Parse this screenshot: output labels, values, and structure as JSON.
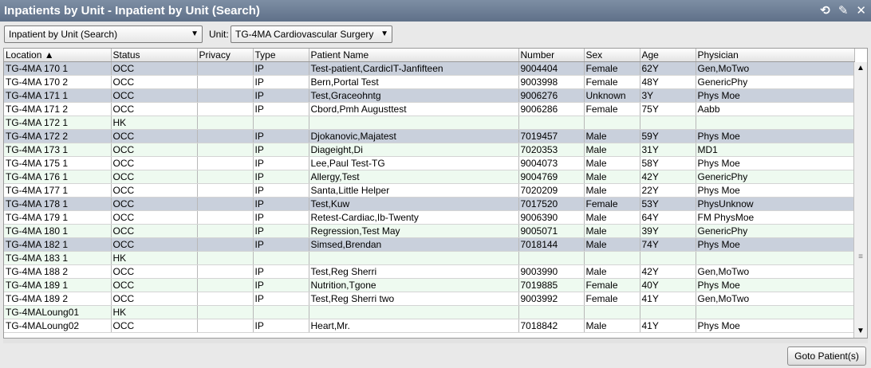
{
  "window": {
    "title": "Inpatients by Unit - Inpatient by Unit (Search)"
  },
  "toolbar": {
    "view_select": "Inpatient by Unit (Search)",
    "unit_label": "Unit:",
    "unit_select": "TG-4MA Cardiovascular Surgery"
  },
  "columns": [
    "Location",
    "Status",
    "Privacy",
    "Type",
    "Patient Name",
    "Number",
    "Sex",
    "Age",
    "Physician"
  ],
  "rows": [
    {
      "location": "TG-4MA 170 1",
      "status": "OCC",
      "privacy": "",
      "type": "IP",
      "name": "Test-patient,CardicIT-Janfifteen",
      "number": "9004404",
      "sex": "Female",
      "age": "62Y",
      "physician": "Gen,MoTwo",
      "style": "sel"
    },
    {
      "location": "TG-4MA 170 2",
      "status": "OCC",
      "privacy": "",
      "type": "IP",
      "name": "Bern,Portal Test",
      "number": "9003998",
      "sex": "Female",
      "age": "48Y",
      "physician": "GenericPhy",
      "style": "r0"
    },
    {
      "location": "TG-4MA 171 1",
      "status": "OCC",
      "privacy": "",
      "type": "IP",
      "name": "Test,Graceohntg",
      "number": "9006276",
      "sex": "Unknown",
      "age": "3Y",
      "physician": "Phys Moe",
      "style": "sel"
    },
    {
      "location": "TG-4MA 171 2",
      "status": "OCC",
      "privacy": "",
      "type": "IP",
      "name": "Cbord,Pmh Augusttest",
      "number": "9006286",
      "sex": "Female",
      "age": "75Y",
      "physician": "Aabb",
      "style": "r0"
    },
    {
      "location": "TG-4MA 172 1",
      "status": "HK",
      "privacy": "",
      "type": "",
      "name": "",
      "number": "",
      "sex": "",
      "age": "",
      "physician": "",
      "style": "r1"
    },
    {
      "location": "TG-4MA 172 2",
      "status": "OCC",
      "privacy": "",
      "type": "IP",
      "name": "Djokanovic,Majatest",
      "number": "7019457",
      "sex": "Male",
      "age": "59Y",
      "physician": "Phys Moe",
      "style": "sel"
    },
    {
      "location": "TG-4MA 173 1",
      "status": "OCC",
      "privacy": "",
      "type": "IP",
      "name": "Diageight,Di",
      "number": "7020353",
      "sex": "Male",
      "age": "31Y",
      "physician": "MD1",
      "style": "r1"
    },
    {
      "location": "TG-4MA 175 1",
      "status": "OCC",
      "privacy": "",
      "type": "IP",
      "name": "Lee,Paul Test-TG",
      "number": "9004073",
      "sex": "Male",
      "age": "58Y",
      "physician": "Phys Moe",
      "style": "r0"
    },
    {
      "location": "TG-4MA 176 1",
      "status": "OCC",
      "privacy": "",
      "type": "IP",
      "name": "Allergy,Test",
      "number": "9004769",
      "sex": "Male",
      "age": "42Y",
      "physician": "GenericPhy",
      "style": "r1"
    },
    {
      "location": "TG-4MA 177 1",
      "status": "OCC",
      "privacy": "",
      "type": "IP",
      "name": "Santa,Little Helper",
      "number": "7020209",
      "sex": "Male",
      "age": "22Y",
      "physician": "Phys Moe",
      "style": "r0"
    },
    {
      "location": "TG-4MA 178 1",
      "status": "OCC",
      "privacy": "",
      "type": "IP",
      "name": "Test,Kuw",
      "number": "7017520",
      "sex": "Female",
      "age": "53Y",
      "physician": "PhysUnknow",
      "style": "sel"
    },
    {
      "location": "TG-4MA 179 1",
      "status": "OCC",
      "privacy": "",
      "type": "IP",
      "name": "Retest-Cardiac,Ib-Twenty",
      "number": "9006390",
      "sex": "Male",
      "age": "64Y",
      "physician": "FM PhysMoe",
      "style": "r0"
    },
    {
      "location": "TG-4MA 180 1",
      "status": "OCC",
      "privacy": "",
      "type": "IP",
      "name": "Regression,Test May",
      "number": "9005071",
      "sex": "Male",
      "age": "39Y",
      "physician": "GenericPhy",
      "style": "r1"
    },
    {
      "location": "TG-4MA 182 1",
      "status": "OCC",
      "privacy": "",
      "type": "IP",
      "name": "Simsed,Brendan",
      "number": "7018144",
      "sex": "Male",
      "age": "74Y",
      "physician": "Phys Moe",
      "style": "sel"
    },
    {
      "location": "TG-4MA 183 1",
      "status": "HK",
      "privacy": "",
      "type": "",
      "name": "",
      "number": "",
      "sex": "",
      "age": "",
      "physician": "",
      "style": "r1"
    },
    {
      "location": "TG-4MA 188 2",
      "status": "OCC",
      "privacy": "",
      "type": "IP",
      "name": "Test,Reg Sherri",
      "number": "9003990",
      "sex": "Male",
      "age": "42Y",
      "physician": "Gen,MoTwo",
      "style": "r0"
    },
    {
      "location": "TG-4MA 189 1",
      "status": "OCC",
      "privacy": "",
      "type": "IP",
      "name": "Nutrition,Tgone",
      "number": "7019885",
      "sex": "Female",
      "age": "40Y",
      "physician": "Phys Moe",
      "style": "r1"
    },
    {
      "location": "TG-4MA 189 2",
      "status": "OCC",
      "privacy": "",
      "type": "IP",
      "name": "Test,Reg Sherri two",
      "number": "9003992",
      "sex": "Female",
      "age": "41Y",
      "physician": "Gen,MoTwo",
      "style": "r0"
    },
    {
      "location": "TG-4MALoung01",
      "status": "HK",
      "privacy": "",
      "type": "",
      "name": "",
      "number": "",
      "sex": "",
      "age": "",
      "physician": "",
      "style": "r1"
    },
    {
      "location": "TG-4MALoung02",
      "status": "OCC",
      "privacy": "",
      "type": "IP",
      "name": "Heart,Mr.",
      "number": "7018842",
      "sex": "Male",
      "age": "41Y",
      "physician": "Phys Moe",
      "style": "r0"
    }
  ],
  "buttons": {
    "goto": "Goto Patient(s)"
  },
  "colors": {
    "titlebar": "#6b7c94",
    "selected_row": "#c9d0dc",
    "alt_row": "#eefaf0"
  },
  "icons": {
    "refresh": "refresh-icon",
    "settings": "wrench-icon",
    "close": "close-icon",
    "sort": "sort-ascending-icon"
  }
}
